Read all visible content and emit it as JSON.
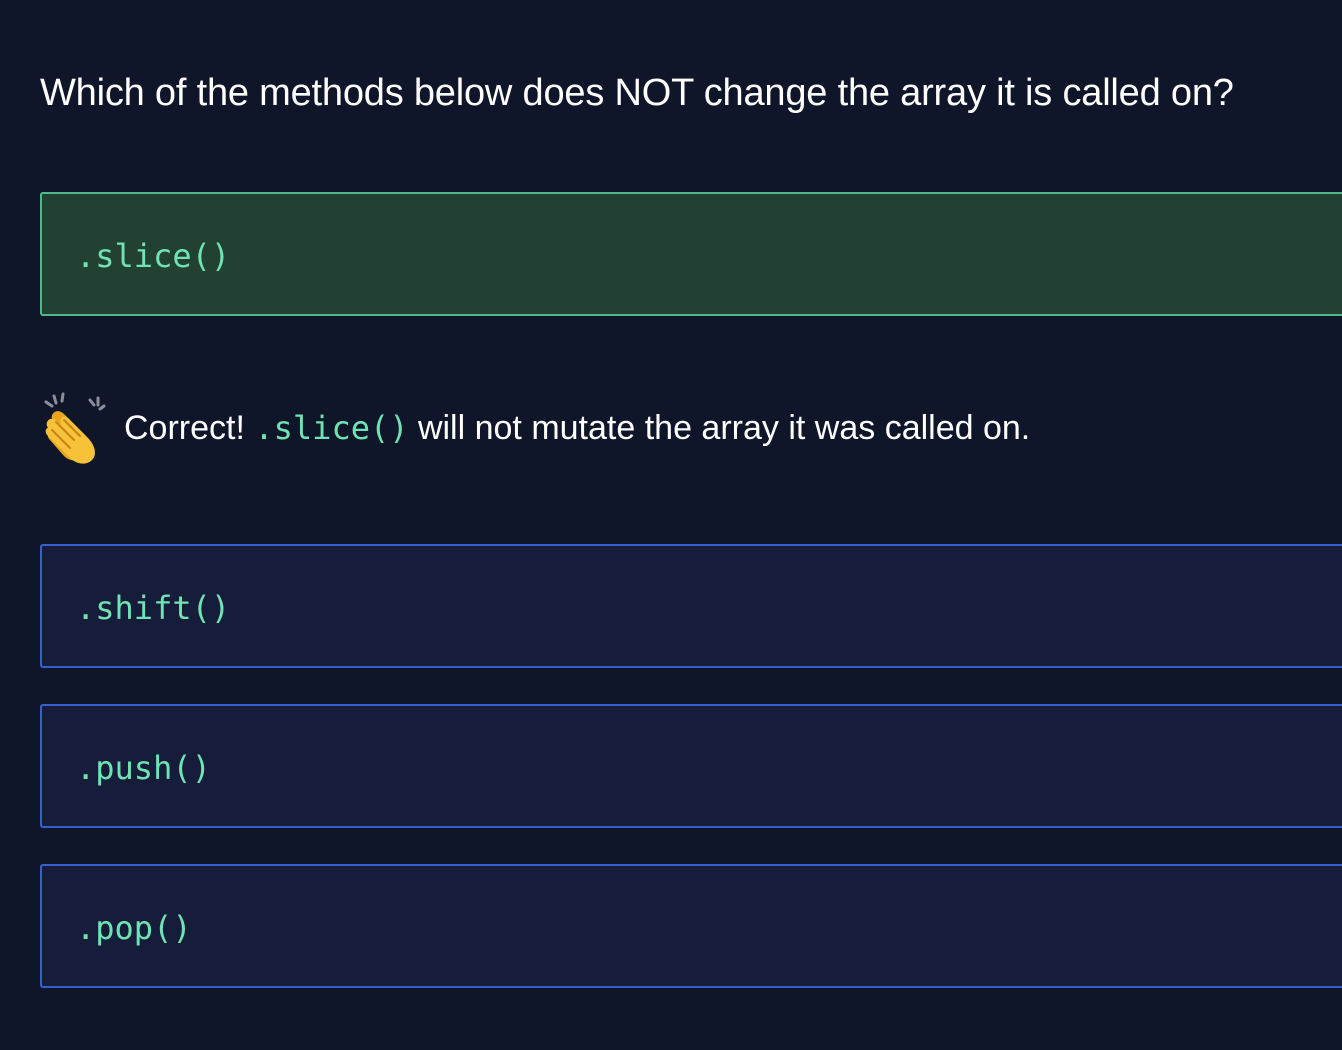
{
  "question": {
    "text": "Which of the methods below does NOT change the array it is called on?"
  },
  "options": [
    {
      "label": ".slice()",
      "state": "correct"
    },
    {
      "label": ".shift()",
      "state": "default"
    },
    {
      "label": ".push()",
      "state": "default"
    },
    {
      "label": ".pop()",
      "state": "default"
    }
  ],
  "feedback": {
    "icon": "clapping-hands-icon",
    "prefix": "Correct!",
    "code": ".slice()",
    "suffix": "will not mutate the array it was called on."
  },
  "colors": {
    "background": "#10162a",
    "option_background": "#161d3a",
    "option_border": "#3a5ed1",
    "correct_background": "#234133",
    "correct_border": "#4fb98a",
    "code_text": "#6fe3b3"
  }
}
